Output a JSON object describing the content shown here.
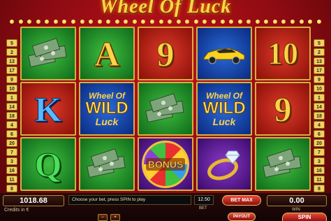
{
  "game": {
    "title": "Wheel Of Luck"
  },
  "paylines": {
    "left": [
      "5",
      "2",
      "13",
      "17",
      "9",
      "10",
      "1",
      "14",
      "18",
      "4",
      "6",
      "20",
      "7",
      "3",
      "16",
      "11",
      "8"
    ],
    "right": [
      "5",
      "2",
      "13",
      "17",
      "9",
      "10",
      "1",
      "14",
      "18",
      "4",
      "6",
      "20",
      "7",
      "3",
      "16",
      "11",
      "8"
    ]
  },
  "reels": [
    [
      {
        "symbol": "money-stack",
        "bg": "green"
      },
      {
        "symbol": "K",
        "bg": "red"
      },
      {
        "symbol": "Q",
        "bg": "green"
      }
    ],
    [
      {
        "symbol": "A",
        "bg": "green"
      },
      {
        "symbol": "wild",
        "bg": "blue"
      },
      {
        "symbol": "money-stack",
        "bg": "green"
      }
    ],
    [
      {
        "symbol": "9",
        "bg": "red"
      },
      {
        "symbol": "money-stack",
        "bg": "green"
      },
      {
        "symbol": "bonus",
        "bg": "purple"
      }
    ],
    [
      {
        "symbol": "sports-car",
        "bg": "blue"
      },
      {
        "symbol": "wild",
        "bg": "blue"
      },
      {
        "symbol": "diamond-ring",
        "bg": "purple"
      }
    ],
    [
      {
        "symbol": "10",
        "bg": "red"
      },
      {
        "symbol": "9",
        "bg": "red"
      },
      {
        "symbol": "money-stack",
        "bg": "green"
      }
    ]
  ],
  "symbol_text": {
    "K": "K",
    "Q": "Q",
    "A": "A",
    "nine": "9",
    "ten": "10",
    "wild_top": "Wheel Of",
    "wild_mid": "WILD",
    "wild_bot": "Luck",
    "bonus": "BONUS"
  },
  "bottom_bar": {
    "credits_value": "1018.68",
    "credits_label": "Credits in €",
    "message": "Choose your bet, press SPIN to play",
    "bet_value": "12.50",
    "bet_label": "BET",
    "betmax_label": "BET MAX",
    "win_value": "0.00",
    "win_label": "WIN",
    "payout_label": "PAYOUT",
    "spin_label": "SPIN"
  },
  "colors": {
    "frame": "#c0121b",
    "gold": "#ffd24a",
    "button_red": "#e84a3a"
  }
}
